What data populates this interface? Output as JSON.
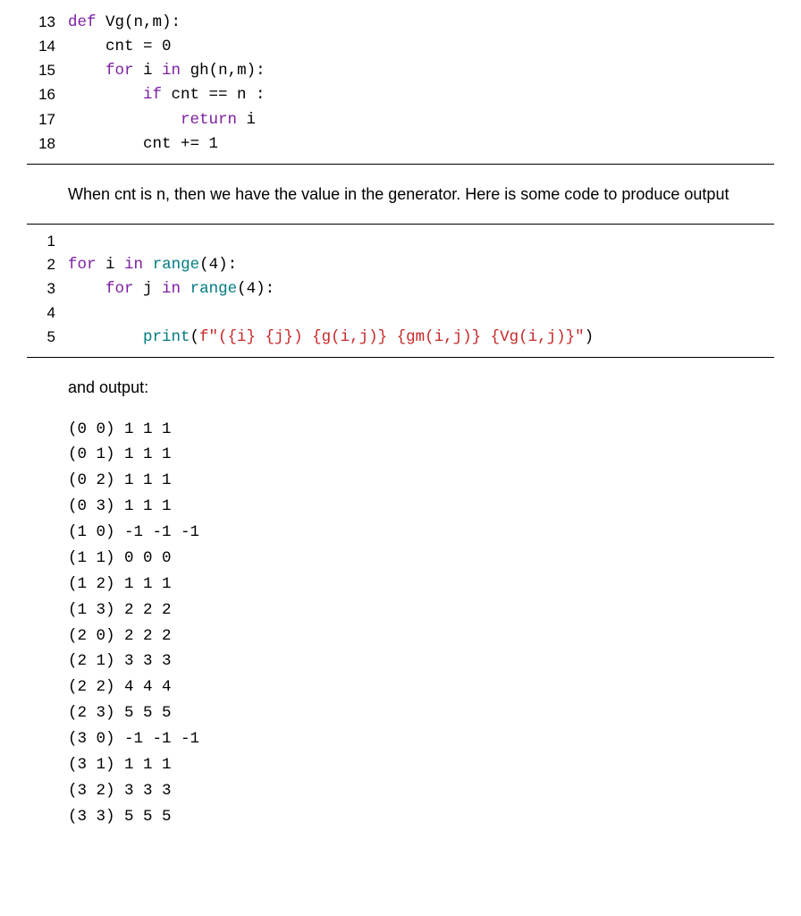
{
  "block1": {
    "line13": {
      "n": "13",
      "t1": "def",
      "t2": " Vg(n,m):"
    },
    "line14": {
      "n": "14",
      "code": "    cnt = 0"
    },
    "line15": {
      "n": "15",
      "t1": "    ",
      "t2": "for",
      "t3": " i ",
      "t4": "in",
      "t5": " gh(n,m):"
    },
    "line16": {
      "n": "16",
      "t1": "        ",
      "t2": "if",
      "t3": " cnt == n :"
    },
    "line17": {
      "n": "17",
      "t1": "            ",
      "t2": "return",
      "t3": " i"
    },
    "line18": {
      "n": "18",
      "code": "        cnt += 1"
    }
  },
  "para1": "When cnt is n, then we have the value in the generator. Here is some code to produce output",
  "block2": {
    "line1": {
      "n": "1",
      "code": ""
    },
    "line2": {
      "n": "2",
      "t1": "for",
      "t2": " i ",
      "t3": "in",
      "t4": " ",
      "t5": "range",
      "t6": "(4):"
    },
    "line3": {
      "n": "3",
      "t1": "    ",
      "t2": "for",
      "t3": " j ",
      "t4": "in",
      "t5": " ",
      "t6": "range",
      "t7": "(4):"
    },
    "line4": {
      "n": "4",
      "code": ""
    },
    "line5": {
      "n": "5",
      "t1": "        ",
      "t2": "print",
      "t3": "(",
      "t4": "f\"({i} {j}) {g(i,j)} {gm(i,j)} {Vg(i,j)}\"",
      "t5": ")"
    }
  },
  "para2": "and output:",
  "output_lines": [
    "(0 0) 1 1 1",
    "(0 1) 1 1 1",
    "(0 2) 1 1 1",
    "(0 3) 1 1 1",
    "(1 0) -1 -1 -1",
    "(1 1) 0 0 0",
    "(1 2) 1 1 1",
    "(1 3) 2 2 2",
    "(2 0) 2 2 2",
    "(2 1) 3 3 3",
    "(2 2) 4 4 4",
    "(2 3) 5 5 5",
    "(3 0) -1 -1 -1",
    "(3 1) 1 1 1",
    "(3 2) 3 3 3",
    "(3 3) 5 5 5"
  ]
}
